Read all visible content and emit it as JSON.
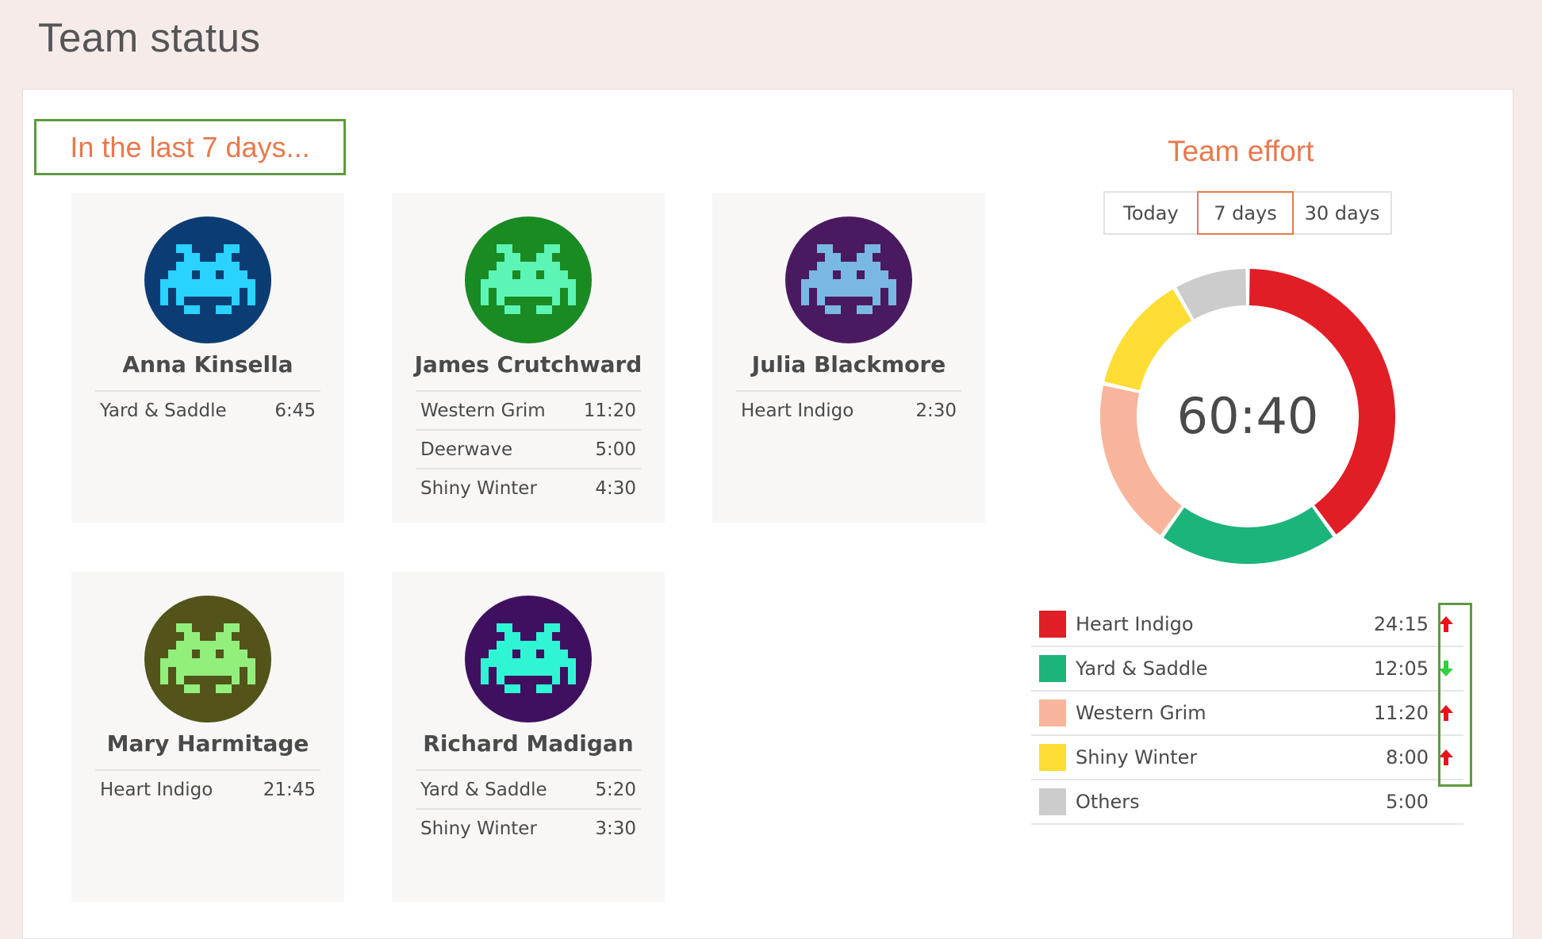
{
  "page": {
    "title": "Team status"
  },
  "period_heading": "In the last 7 days...",
  "members": [
    {
      "name": "Anna Kinsella",
      "avatar": {
        "bg": "#0b3d74",
        "fg": "#29d2ff",
        "icon": "pixel-invader-avatar"
      },
      "projects": [
        {
          "name": "Yard & Saddle",
          "time": "6:45"
        }
      ]
    },
    {
      "name": "James Crutchward",
      "avatar": {
        "bg": "#1a8a22",
        "fg": "#5cf5b5",
        "icon": "pixel-invader-avatar"
      },
      "projects": [
        {
          "name": "Western Grim",
          "time": "11:20"
        },
        {
          "name": "Deerwave",
          "time": "5:00"
        },
        {
          "name": "Shiny Winter",
          "time": "4:30"
        }
      ]
    },
    {
      "name": "Julia Blackmore",
      "avatar": {
        "bg": "#4a1a60",
        "fg": "#79b8e3",
        "icon": "pixel-invader-avatar"
      },
      "projects": [
        {
          "name": "Heart Indigo",
          "time": "2:30"
        }
      ]
    },
    {
      "name": "Mary Harmitage",
      "avatar": {
        "bg": "#52541a",
        "fg": "#92ef7c",
        "icon": "pixel-invader-avatar"
      },
      "projects": [
        {
          "name": "Heart Indigo",
          "time": "21:45"
        }
      ]
    },
    {
      "name": "Richard Madigan",
      "avatar": {
        "bg": "#3f1060",
        "fg": "#2ff5d5",
        "icon": "pixel-invader-avatar"
      },
      "projects": [
        {
          "name": "Yard & Saddle",
          "time": "5:20"
        },
        {
          "name": "Shiny Winter",
          "time": "3:30"
        }
      ]
    }
  ],
  "effort": {
    "title": "Team effort",
    "tabs": [
      "Today",
      "7 days",
      "30 days"
    ],
    "active_tab": "7 days",
    "total": "60:40",
    "items": [
      {
        "name": "Heart Indigo",
        "time": "24:15",
        "color": "#e11d26",
        "trend": "up"
      },
      {
        "name": "Yard & Saddle",
        "time": "12:05",
        "color": "#1bb47a",
        "trend": "down"
      },
      {
        "name": "Western Grim",
        "time": "11:20",
        "color": "#f8b59b",
        "trend": "up"
      },
      {
        "name": "Shiny Winter",
        "time": "8:00",
        "color": "#fedd34",
        "trend": "up"
      },
      {
        "name": "Others",
        "time": "5:00",
        "color": "#cccccc",
        "trend": ""
      }
    ],
    "trend_colors": {
      "up": "#e8131c",
      "down": "#2fd23b"
    }
  },
  "chart_data": {
    "type": "pie",
    "title": "Team effort",
    "center_label": "60:40",
    "categories": [
      "Heart Indigo",
      "Yard & Saddle",
      "Western Grim",
      "Shiny Winter",
      "Others"
    ],
    "values": [
      24.25,
      12.08,
      11.33,
      8.0,
      5.0
    ],
    "units": "hours",
    "colors": [
      "#e11d26",
      "#1bb47a",
      "#f8b59b",
      "#fedd34",
      "#cccccc"
    ]
  }
}
